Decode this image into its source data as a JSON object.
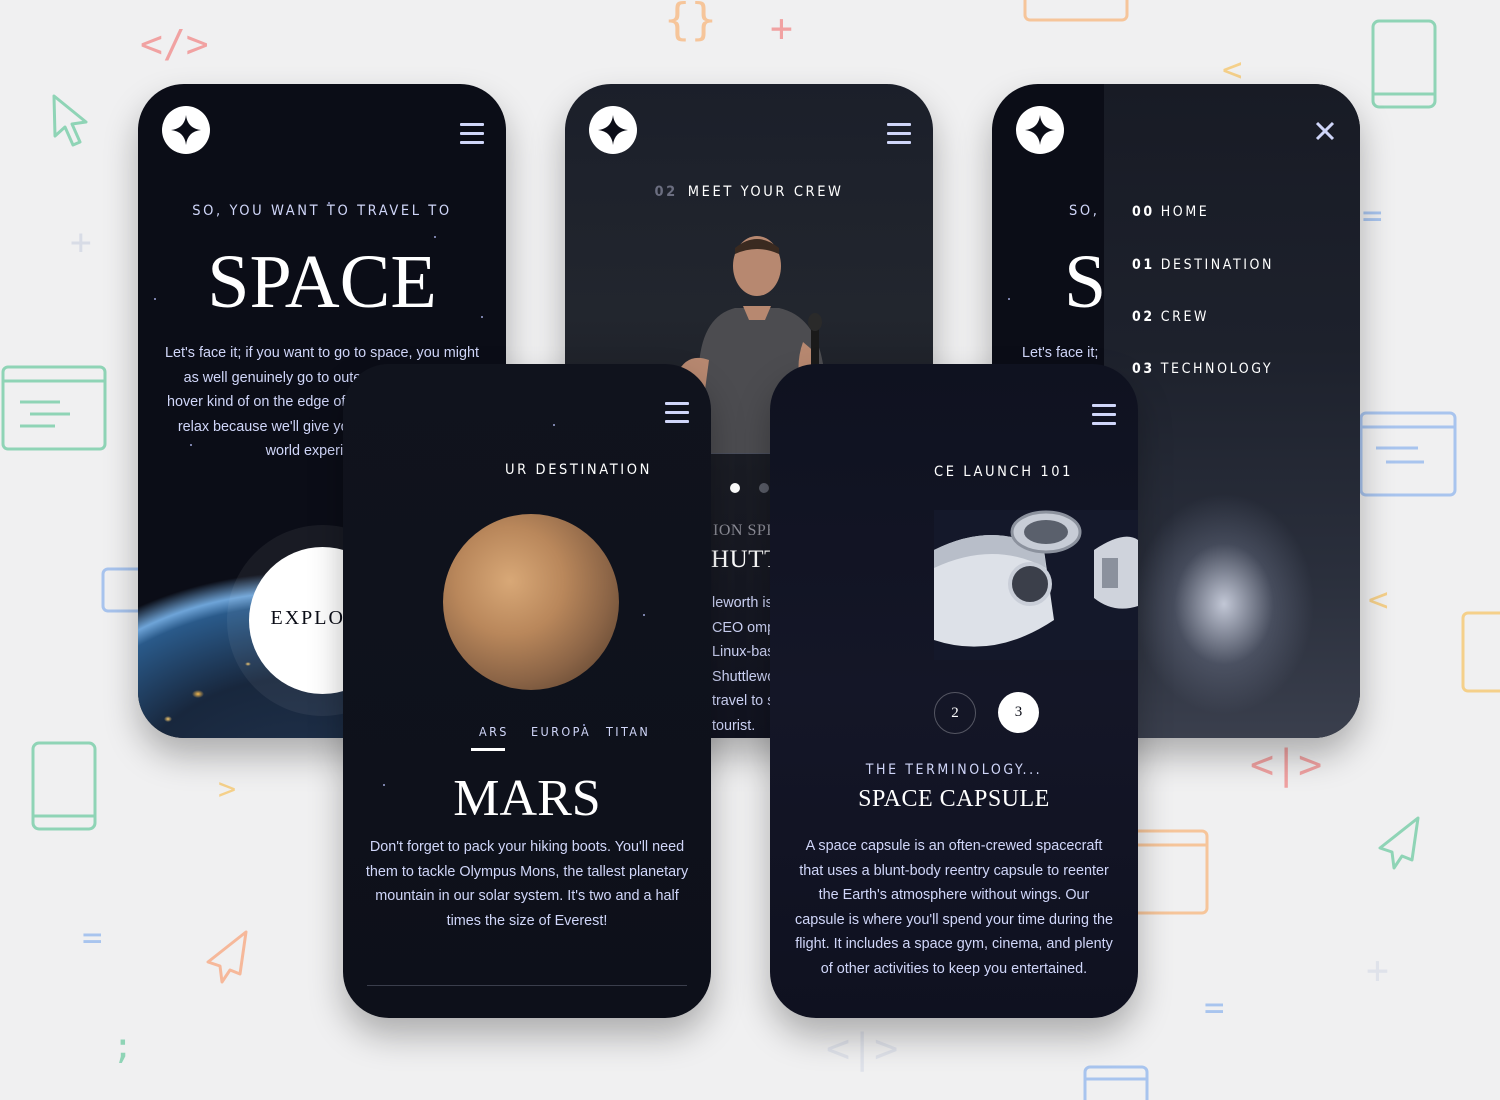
{
  "colors": {
    "page_bg": "#f0f0f1",
    "dark": "#0b0d17",
    "light_blue": "#d0d6f9",
    "white": "#ffffff"
  },
  "home": {
    "subtitle": "SO, YOU WANT TO TRAVEL TO",
    "title": "SPACE",
    "body": "Let's face it; if you want to go to space, you might as well genuinely go to outer space and not hover kind of on the edge of it. Well sit back, and relax because we'll give you a truly out of this world experience!",
    "explore_label": "EXPLORE"
  },
  "crew": {
    "heading_num": "02",
    "heading_text": "MEET YOUR CREW",
    "role": "ION SPECIALIST",
    "name": "HUTTLEWORTH",
    "bio": "leworth is the founder and CEO ompany behind the Linux-based system. Shuttleworth became frican to travel to space as a pace tourist."
  },
  "menu": {
    "close_icon": "close-icon",
    "peek_subtitle": "SO, Y",
    "peek_title": "S",
    "peek_body": "Let's face it;",
    "items": [
      {
        "num": "00",
        "label": "HOME"
      },
      {
        "num": "01",
        "label": "DESTINATION"
      },
      {
        "num": "02",
        "label": "CREW"
      },
      {
        "num": "03",
        "label": "TECHNOLOGY"
      }
    ]
  },
  "destination": {
    "heading": "UR DESTINATION",
    "tabs": [
      "ARS",
      "EUROPA",
      "TITAN"
    ],
    "planet_name": "MARS",
    "description": "Don't forget to pack your hiking boots. You'll need them to tackle Olympus Mons, the tallest planetary mountain in our solar system. It's two and a half times the size of Everest!"
  },
  "technology": {
    "heading": "CE LAUNCH 101",
    "steps": [
      "2",
      "3"
    ],
    "terminology": "THE TERMINOLOGY...",
    "title": "SPACE CAPSULE",
    "description": "A space capsule is an often-crewed spacecraft that uses a blunt-body reentry capsule to reenter the Earth's atmosphere without wings. Our capsule is where you'll spend your time during the flight. It includes a space gym, cinema, and plenty of other activities to keep you entertained."
  }
}
